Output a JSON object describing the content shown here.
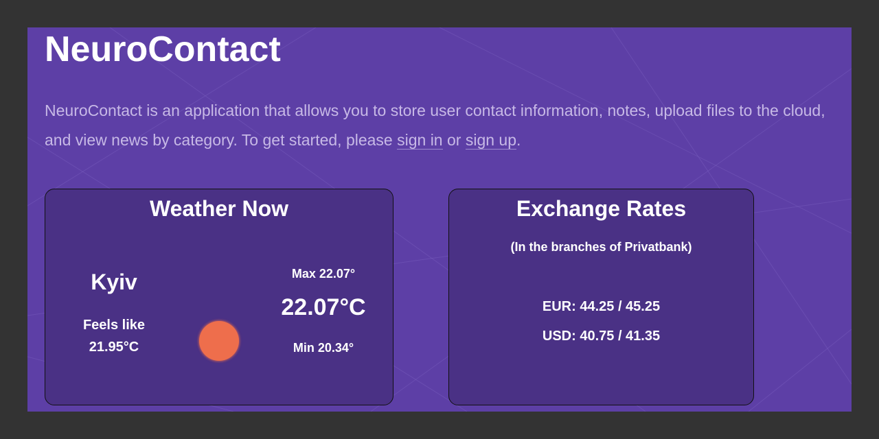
{
  "app": {
    "title": "NeuroContact"
  },
  "intro": {
    "text_before": "NeuroContact is an application that allows you to store user contact information, notes, upload files to the cloud, and view news by category. To get started, please ",
    "sign_in": "sign in",
    "or": " or ",
    "sign_up": "sign up",
    "end": "."
  },
  "weather": {
    "title": "Weather Now",
    "city": "Kyiv",
    "feels_like_label": "Feels like",
    "feels_like_value": "21.95°C",
    "max": "Max 22.07°",
    "current": "22.07°C",
    "min": "Min 20.34°",
    "icon": "sun-icon"
  },
  "rates": {
    "title": "Exchange Rates",
    "subtitle": "(In the branches of Privatbank)",
    "eur": "EUR: 44.25 / 45.25",
    "usd": "USD: 40.75 / 41.35"
  },
  "colors": {
    "page_background": "#5d3fa6",
    "card_background": "#4a3185",
    "intro_text": "#c7b9e6",
    "sun": "#ee6e4c",
    "outer_frame": "#333333"
  }
}
